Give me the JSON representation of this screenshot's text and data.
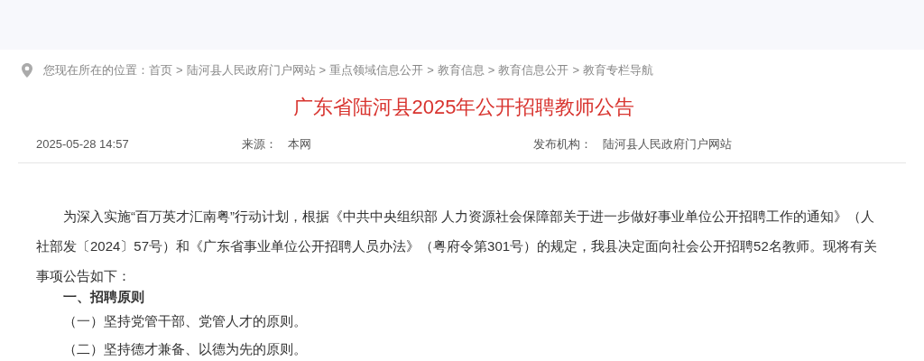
{
  "breadcrumb": {
    "prefix": "您现在所在的位置：",
    "separator": ">",
    "items": [
      "首页",
      "陆河县人民政府门户网站",
      "重点领域信息公开",
      "教育信息",
      "教育信息公开",
      "教育专栏导航"
    ]
  },
  "article": {
    "title": "广东省陆河县2025年公开招聘教师公告",
    "meta": {
      "date": "2025-05-28 14:57",
      "source_label": "来源：",
      "source": "本网",
      "publisher_label": "发布机构：",
      "publisher": "陆河县人民政府门户网站"
    },
    "body": [
      {
        "kind": "paragraph",
        "text": "为深入实施“百万英才汇南粤”行动计划，根据《中共中央组织部 人力资源社会保障部关于进一步做好事业单位公开招聘工作的通知》（人社部发〔2024〕57号）和《广东省事业单位公开招聘人员办法》（粤府令第301号）的规定，我县决定面向社会公开招聘52名教师。现将有关事项公告如下："
      },
      {
        "kind": "heading",
        "text": "一、招聘原则"
      },
      {
        "kind": "item",
        "text": "（一）坚持党管干部、党管人才的原则。"
      },
      {
        "kind": "item",
        "text": "（二）坚持德才兼备、以德为先的原则。"
      }
    ]
  }
}
